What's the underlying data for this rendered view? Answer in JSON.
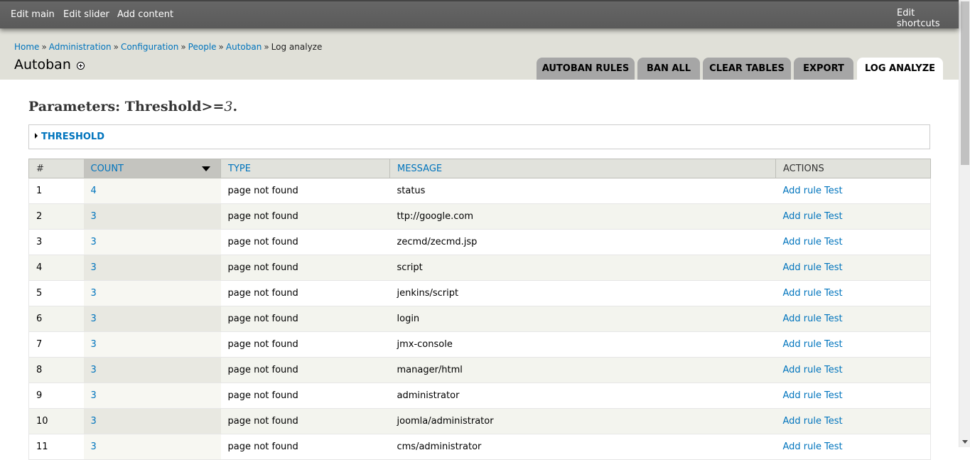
{
  "toolbar": {
    "items": [
      "Edit main",
      "Edit slider",
      "Add content"
    ],
    "edit_shortcuts": "Edit shortcuts"
  },
  "breadcrumb": [
    "Home",
    "Administration",
    "Configuration",
    "People",
    "Autoban",
    "Log analyze"
  ],
  "breadcrumb_separator": "»",
  "page_title": "Autoban",
  "tabs": [
    {
      "label": "Autoban rules",
      "active": false
    },
    {
      "label": "Ban all",
      "active": false
    },
    {
      "label": "Clear tables",
      "active": false
    },
    {
      "label": "Export",
      "active": false
    },
    {
      "label": "Log analyze",
      "active": true
    }
  ],
  "parameters": {
    "prefix": "Parameters: Threshold>=",
    "value": "3",
    "suffix": "."
  },
  "fieldset": {
    "legend": "Threshold"
  },
  "table": {
    "headers": [
      "#",
      "Count",
      "Type",
      "Message",
      "Actions"
    ],
    "sorted_column": "Count",
    "rows": [
      {
        "num": "1",
        "count": "4",
        "type": "page not found",
        "message": "status",
        "actions": [
          "Add rule",
          "Test"
        ]
      },
      {
        "num": "2",
        "count": "3",
        "type": "page not found",
        "message": "ttp://google.com",
        "actions": [
          "Add rule",
          "Test"
        ]
      },
      {
        "num": "3",
        "count": "3",
        "type": "page not found",
        "message": "zecmd/zecmd.jsp",
        "actions": [
          "Add rule",
          "Test"
        ]
      },
      {
        "num": "4",
        "count": "3",
        "type": "page not found",
        "message": "script",
        "actions": [
          "Add rule",
          "Test"
        ]
      },
      {
        "num": "5",
        "count": "3",
        "type": "page not found",
        "message": "jenkins/script",
        "actions": [
          "Add rule",
          "Test"
        ]
      },
      {
        "num": "6",
        "count": "3",
        "type": "page not found",
        "message": "login",
        "actions": [
          "Add rule",
          "Test"
        ]
      },
      {
        "num": "7",
        "count": "3",
        "type": "page not found",
        "message": "jmx-console",
        "actions": [
          "Add rule",
          "Test"
        ]
      },
      {
        "num": "8",
        "count": "3",
        "type": "page not found",
        "message": "manager/html",
        "actions": [
          "Add rule",
          "Test"
        ]
      },
      {
        "num": "9",
        "count": "3",
        "type": "page not found",
        "message": "administrator",
        "actions": [
          "Add rule",
          "Test"
        ]
      },
      {
        "num": "10",
        "count": "3",
        "type": "page not found",
        "message": "joomla/administrator",
        "actions": [
          "Add rule",
          "Test"
        ]
      },
      {
        "num": "11",
        "count": "3",
        "type": "page not found",
        "message": "cms/administrator",
        "actions": [
          "Add rule",
          "Test"
        ]
      }
    ]
  },
  "colors": {
    "toolbar_bg": "#5f5f5f",
    "header_bg": "#e0e0d8",
    "link": "#0074bd",
    "tab_bg": "#a6a6a6",
    "tab_active_bg": "#ffffff"
  }
}
